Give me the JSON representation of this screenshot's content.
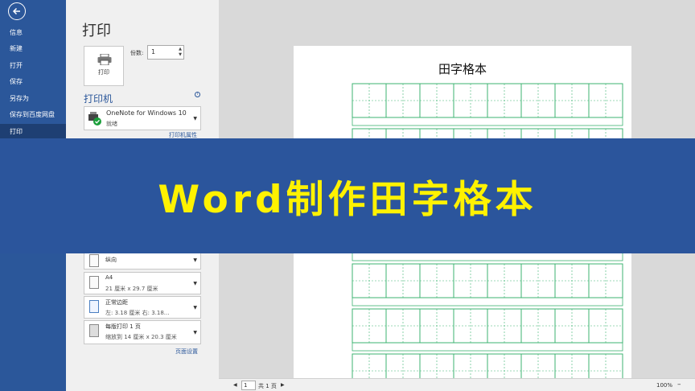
{
  "sidebar": {
    "items": [
      {
        "label": "信息"
      },
      {
        "label": "新建"
      },
      {
        "label": "打开"
      },
      {
        "label": "保存"
      },
      {
        "label": "另存为"
      },
      {
        "label": "保存到百度网盘"
      },
      {
        "label": "打印",
        "selected": true
      }
    ],
    "accent_color": "#2b579a"
  },
  "panel": {
    "title": "打印",
    "print_button": "打印",
    "copies_label": "份数:",
    "copies_value": "1",
    "printer_heading": "打印机",
    "printer_name": "OneNote for Windows 10",
    "printer_status": "就绪",
    "printer_properties": "打印机属性",
    "options": [
      {
        "main": "纵向",
        "sub": ""
      },
      {
        "main": "A4",
        "sub": "21 厘米 x 29.7 厘米"
      },
      {
        "main": "正常边距",
        "sub": "左:  3.18 厘米    右:  3.18..."
      },
      {
        "main": "每版打印 1 页",
        "sub": "缩放到 14 厘米 x 20.3 厘米"
      }
    ],
    "page_setup": "页面设置"
  },
  "preview": {
    "doc_title": "田字格本",
    "grid_color": "#3cb371"
  },
  "statusbar": {
    "page_value": "1",
    "page_total": "共 1 页",
    "zoom": "100%"
  },
  "banner": {
    "text": "Word制作田字格本",
    "bg_color": "#2b559c",
    "text_color": "#fff200"
  }
}
